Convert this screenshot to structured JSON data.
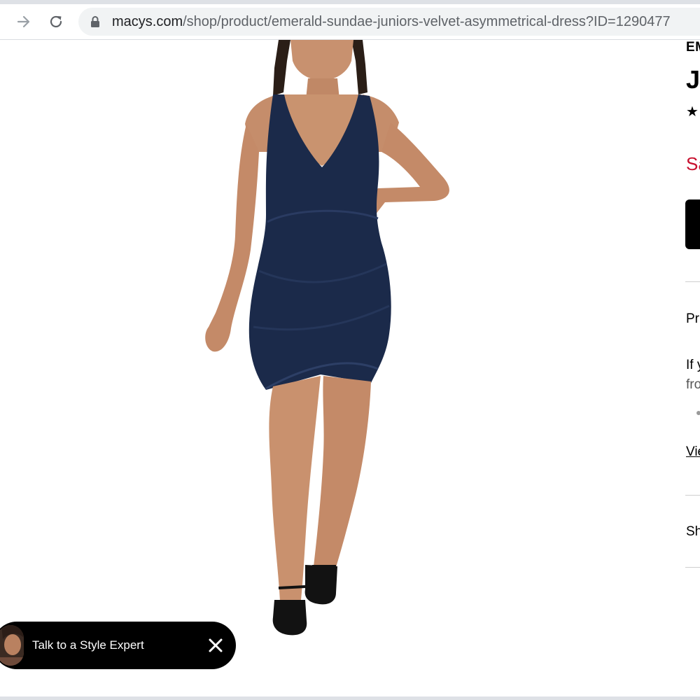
{
  "browser": {
    "url_host": "macys.com",
    "url_path": "/shop/product/emerald-sundae-juniors-velvet-asymmetrical-dress?ID=1290477"
  },
  "product": {
    "brand_fragment": "EM",
    "title_fragment": "J",
    "rating_fragment": "★",
    "sale_fragment": "Sa",
    "pricing_fragment": "Pr",
    "info_line1_fragment": "If y",
    "info_line2_fragment": "fro",
    "view_link_fragment": "Vie",
    "shipping_fragment": "Sh"
  },
  "chat": {
    "label": "Talk to a Style Expert"
  },
  "colors": {
    "sale_red": "#c8102e",
    "chat_background": "#000000",
    "dress_navy": "#1b2a4a"
  },
  "icons": {
    "forward": "arrow-right-icon",
    "reload": "reload-icon",
    "lock": "lock-icon",
    "close": "close-icon"
  }
}
